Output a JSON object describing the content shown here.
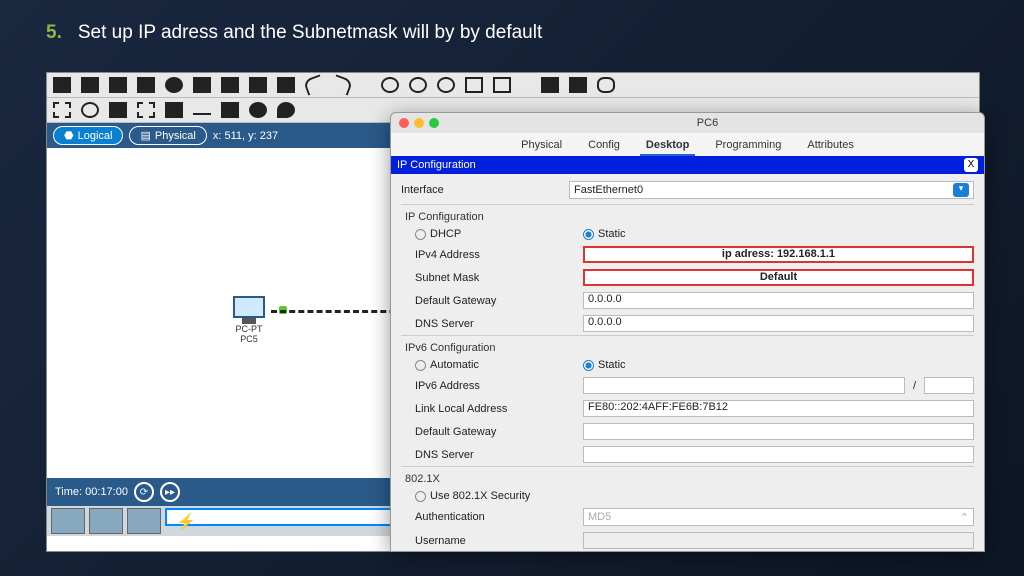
{
  "slide": {
    "num": "5.",
    "title": "Set up IP adress and the Subnetmask will by by default"
  },
  "app": {
    "view": {
      "logical": "Logical",
      "physical": "Physical",
      "coords": "x: 511, y: 237"
    },
    "device": {
      "type": "PC-PT",
      "name": "PC5"
    },
    "time": {
      "label": "Time: 00:17:00"
    }
  },
  "dialog": {
    "title": "PC6",
    "tabs": [
      "Physical",
      "Config",
      "Desktop",
      "Programming",
      "Attributes"
    ],
    "active_tab": "Desktop",
    "panel_title": "IP Configuration",
    "interface": {
      "label": "Interface",
      "value": "FastEthernet0"
    },
    "ip4": {
      "section": "IP Configuration",
      "dhcp": "DHCP",
      "static": "Static",
      "addr_label": "IPv4 Address",
      "addr_value": "ip adress: 192.168.1.1",
      "mask_label": "Subnet Mask",
      "mask_value": "Default",
      "gw_label": "Default Gateway",
      "gw_value": "0.0.0.0",
      "dns_label": "DNS Server",
      "dns_value": "0.0.0.0"
    },
    "ip6": {
      "section": "IPv6 Configuration",
      "auto": "Automatic",
      "static": "Static",
      "addr_label": "IPv6 Address",
      "slash": "/",
      "ll_label": "Link Local Address",
      "ll_value": "FE80::202:4AFF:FE6B:7B12",
      "gw_label": "Default Gateway",
      "dns_label": "DNS Server"
    },
    "x802": {
      "section": "802.1X",
      "use": "Use 802.1X Security",
      "auth_label": "Authentication",
      "auth_value": "MD5",
      "user_label": "Username"
    }
  }
}
